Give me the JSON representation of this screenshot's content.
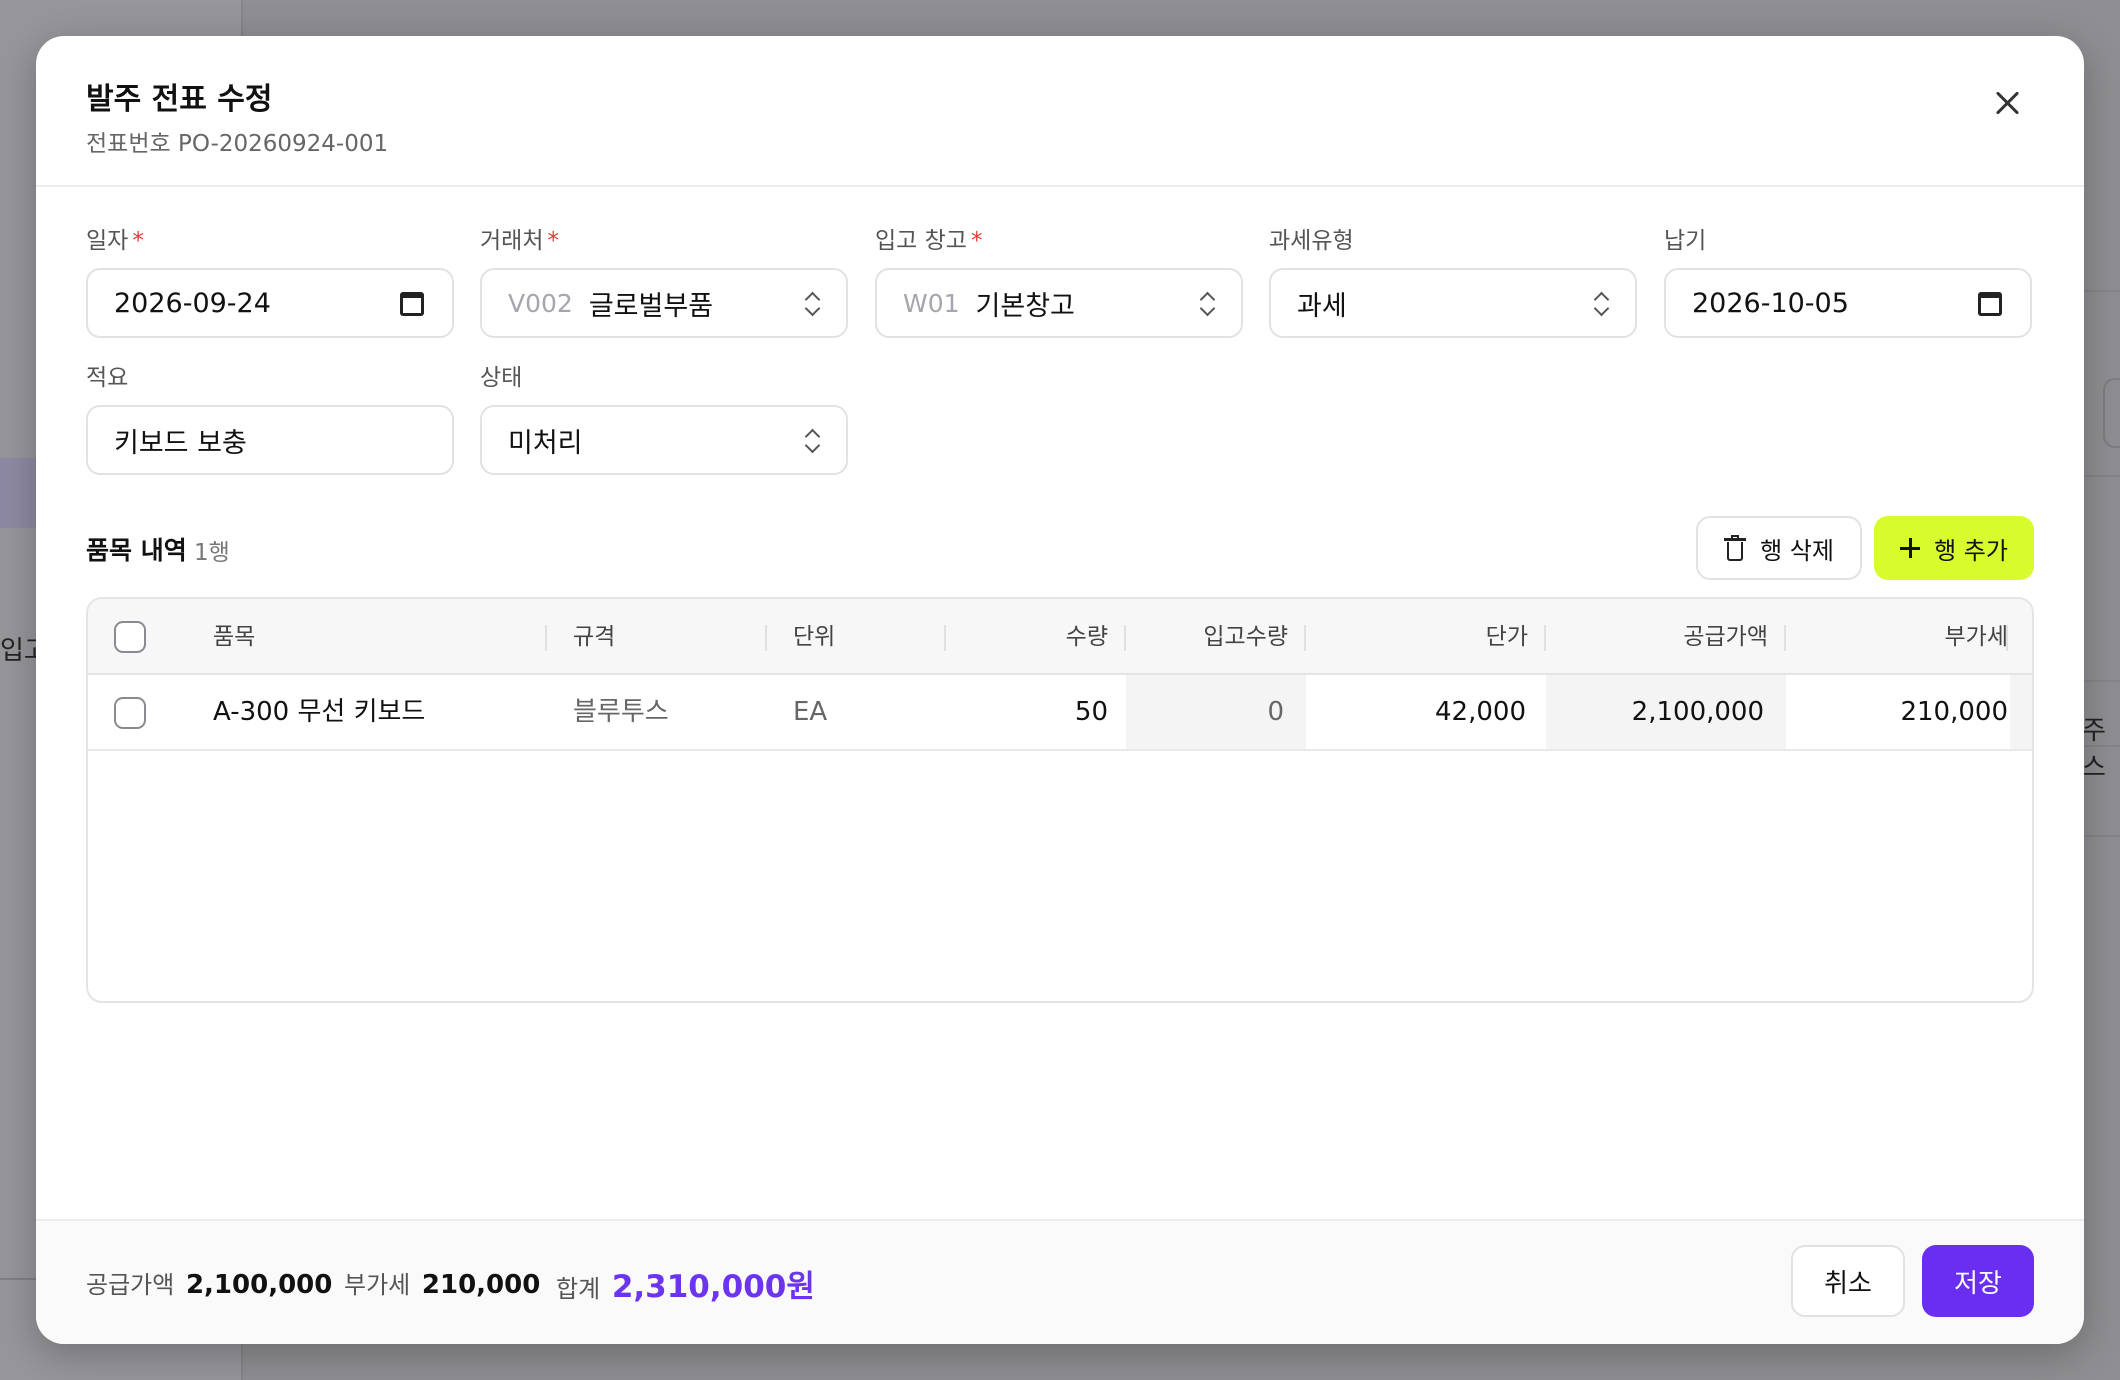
{
  "background": {
    "left_text": "입고",
    "right_text": "주스"
  },
  "modal": {
    "title": "발주 전표 수정",
    "subtitle": "전표번호 PO-20260924-001"
  },
  "fields": {
    "date": {
      "label": "일자",
      "value": "2026-09-24",
      "required": true
    },
    "vendor": {
      "label": "거래처",
      "code": "V002",
      "value": "글로벌부품",
      "required": true
    },
    "warehouse": {
      "label": "입고 창고",
      "code": "W01",
      "value": "기본창고",
      "required": true
    },
    "tax_type": {
      "label": "과세유형",
      "value": "과세"
    },
    "due_date": {
      "label": "납기",
      "value": "2026-10-05"
    },
    "memo": {
      "label": "적요",
      "value": "키보드 보충"
    },
    "status": {
      "label": "상태",
      "value": "미처리"
    },
    "required_mark": "*"
  },
  "items": {
    "title": "품목 내역",
    "count": "1행",
    "delete_label": "행 삭제",
    "add_label": "행 추가",
    "columns": [
      "품목",
      "규격",
      "단위",
      "수량",
      "입고수량",
      "단가",
      "공급가액",
      "부가세"
    ],
    "rows": [
      {
        "item": "A-300 무선 키보드",
        "spec": "블루투스",
        "unit": "EA",
        "qty": "50",
        "received": "0",
        "price": "42,000",
        "supply": "2,100,000",
        "vat": "210,000"
      }
    ]
  },
  "footer": {
    "supply_label": "공급가액",
    "supply_value": "2,100,000",
    "vat_label": "부가세",
    "vat_value": "210,000",
    "total_label": "합계",
    "total_value": "2,310,000원",
    "cancel_label": "취소",
    "save_label": "저장"
  },
  "colors": {
    "accent": "#6a2ef0",
    "add_button": "#d8fb2e",
    "required": "#e53935",
    "total": "#6d34f0"
  }
}
